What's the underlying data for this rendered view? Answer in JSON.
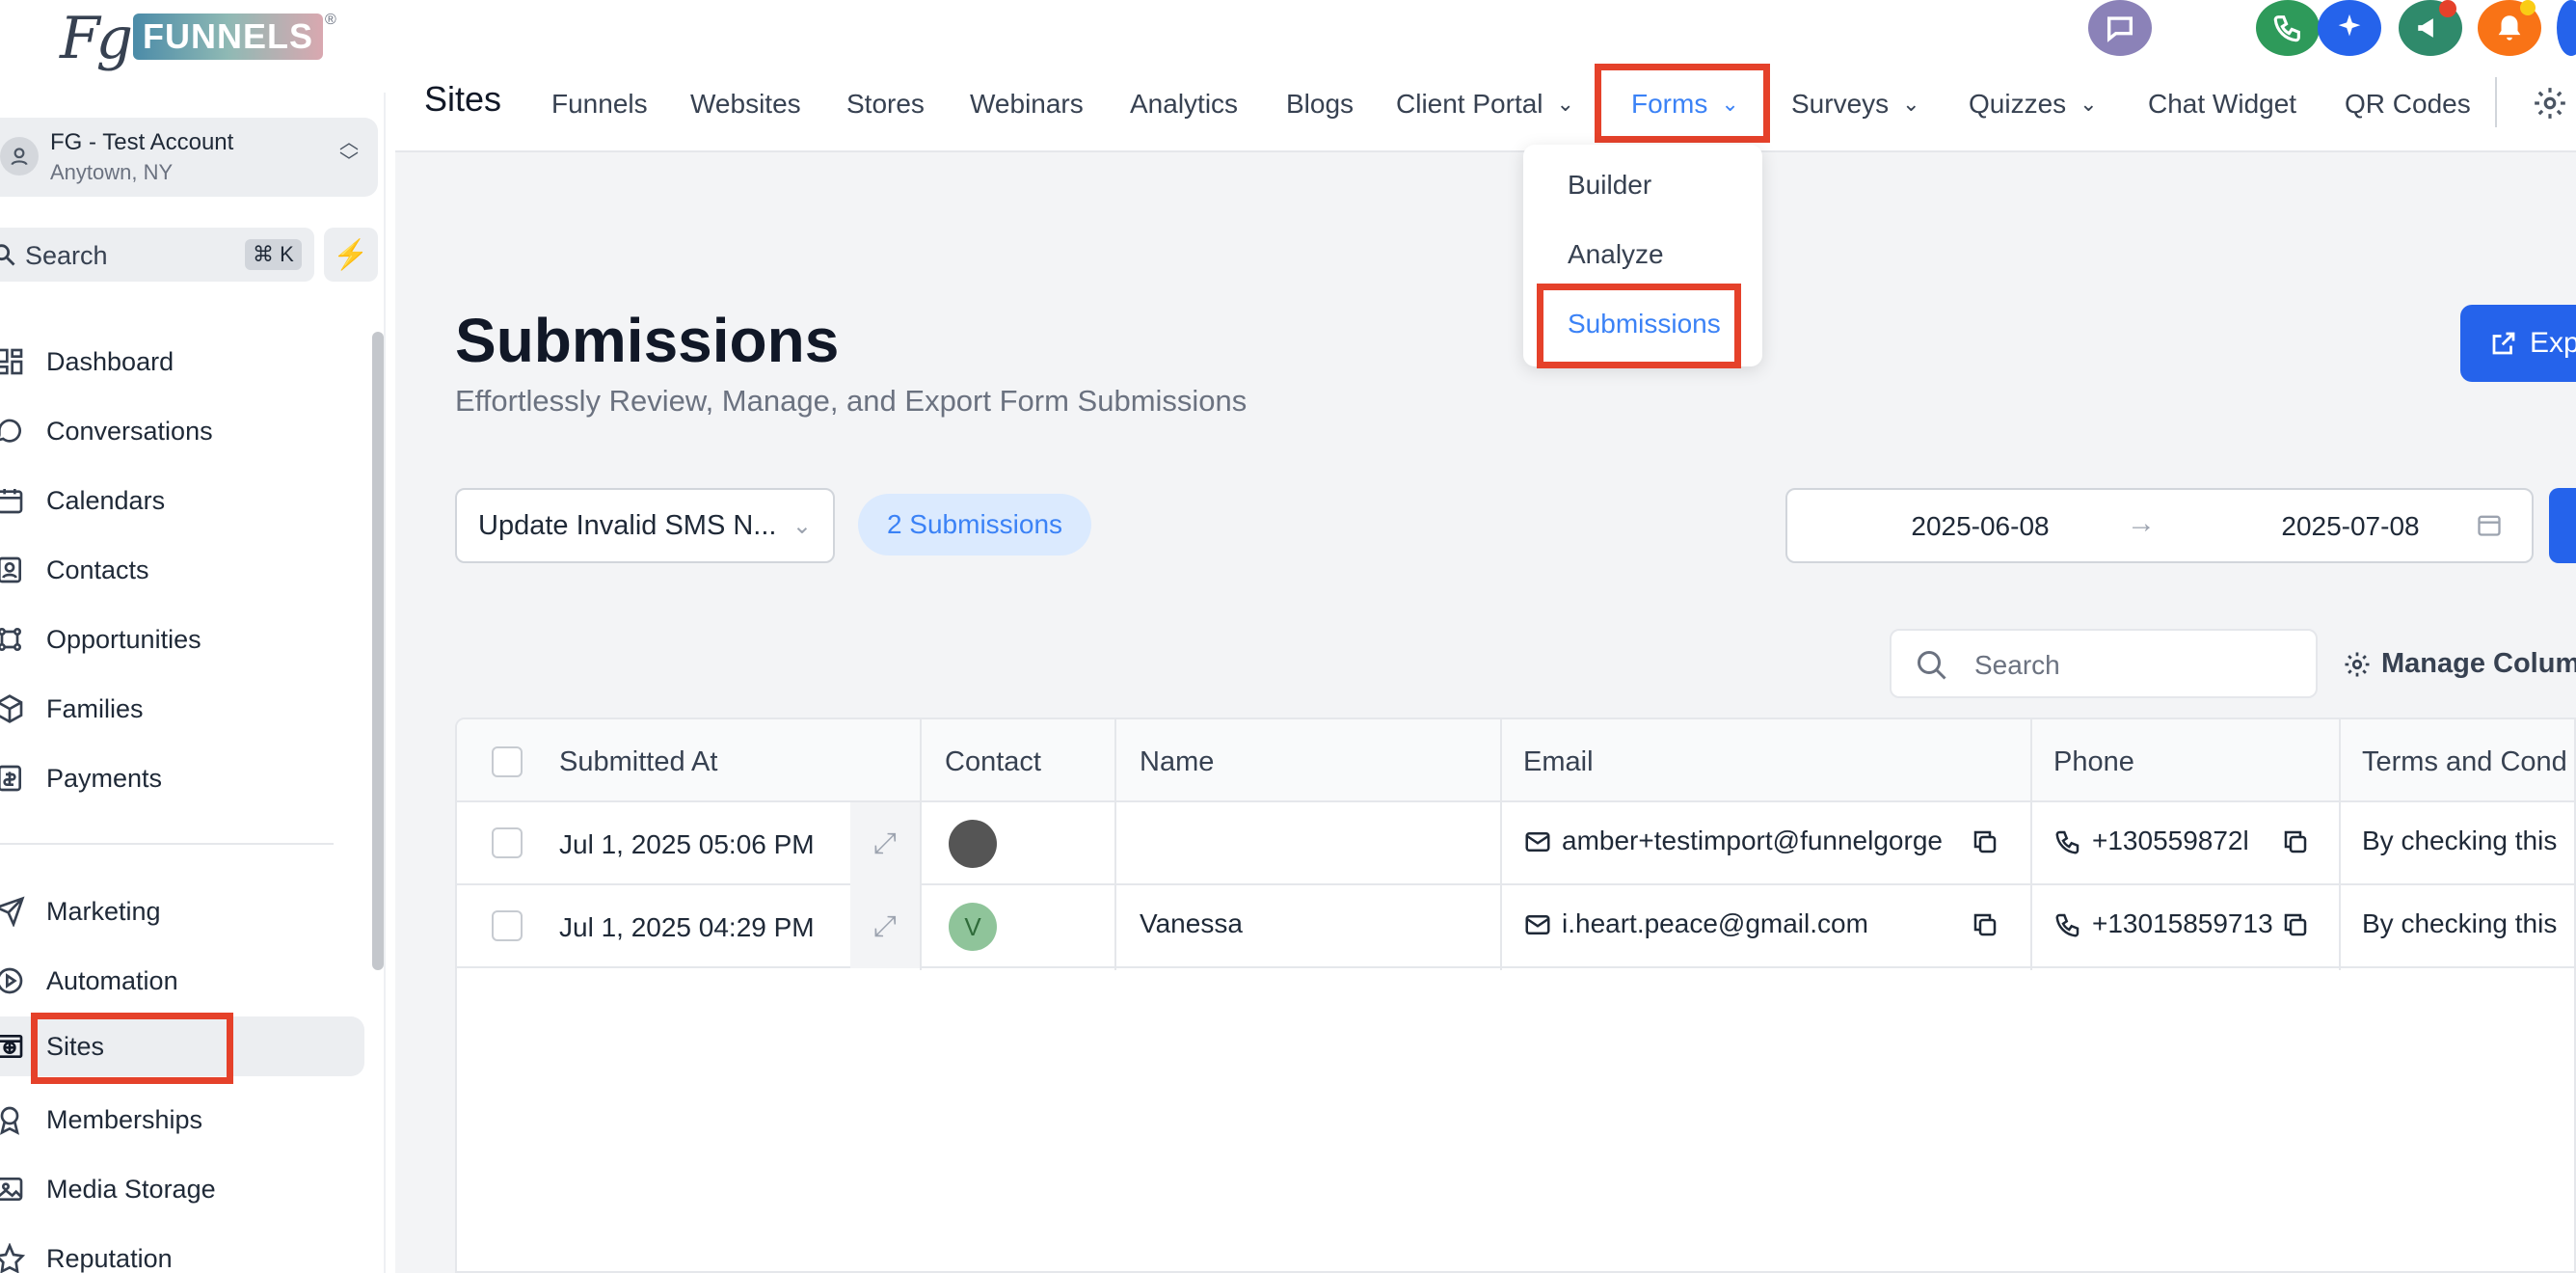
{
  "brand": {
    "logo_mark": "Fg",
    "logo_text": "FUNNELS",
    "logo_reg": "®"
  },
  "account": {
    "name": "FG - Test Account",
    "location": "Anytown, NY"
  },
  "sidebar": {
    "search_label": "Search",
    "search_shortcut": "⌘ K",
    "items": [
      {
        "label": "Dashboard",
        "icon": "dashboard-icon"
      },
      {
        "label": "Conversations",
        "icon": "chat-bubble-icon"
      },
      {
        "label": "Calendars",
        "icon": "calendar-icon"
      },
      {
        "label": "Contacts",
        "icon": "contacts-icon"
      },
      {
        "label": "Opportunities",
        "icon": "opportunities-icon"
      },
      {
        "label": "Families",
        "icon": "box-icon"
      },
      {
        "label": "Payments",
        "icon": "payments-icon"
      },
      {
        "label": "Marketing",
        "icon": "send-icon"
      },
      {
        "label": "Automation",
        "icon": "automation-icon"
      },
      {
        "label": "Sites",
        "icon": "globe-icon"
      },
      {
        "label": "Memberships",
        "icon": "badge-icon"
      },
      {
        "label": "Media Storage",
        "icon": "image-icon"
      },
      {
        "label": "Reputation",
        "icon": "star-icon"
      }
    ]
  },
  "topnav": {
    "title": "Sites",
    "items": [
      "Funnels",
      "Websites",
      "Stores",
      "Webinars",
      "Analytics",
      "Blogs",
      "Client Portal",
      "Forms",
      "Surveys",
      "Quizzes",
      "Chat Widget",
      "QR Codes"
    ]
  },
  "forms_menu": {
    "items": [
      "Builder",
      "Analyze",
      "Submissions"
    ]
  },
  "page": {
    "title": "Submissions",
    "subtitle": "Effortlessly Review, Manage, and Export Form Submissions",
    "export_label": "Exp"
  },
  "filters": {
    "form_select": "Update Invalid SMS N...",
    "submissions_count": "2 Submissions",
    "date_from": "2025-06-08",
    "date_to": "2025-07-08"
  },
  "table": {
    "search_placeholder": "Search",
    "manage_columns": "Manage Colum",
    "headers": [
      "Submitted At",
      "Contact",
      "Name",
      "Email",
      "Phone",
      "Terms and Cond"
    ],
    "rows": [
      {
        "submitted": "Jul 1, 2025 05:06 PM",
        "avatar": "",
        "name": "",
        "email": "amber+testimport@funnelgorge",
        "phone": "+130559872l",
        "terms": "By checking this"
      },
      {
        "submitted": "Jul 1, 2025 04:29 PM",
        "avatar": "V",
        "name": "Vanessa",
        "email": "i.heart.peace@gmail.com",
        "phone": "+13015859713",
        "terms": "By checking this"
      }
    ]
  },
  "colors": {
    "accent": "#2563eb",
    "highlight": "#e5412a",
    "active_nav": "#3b82f6"
  }
}
